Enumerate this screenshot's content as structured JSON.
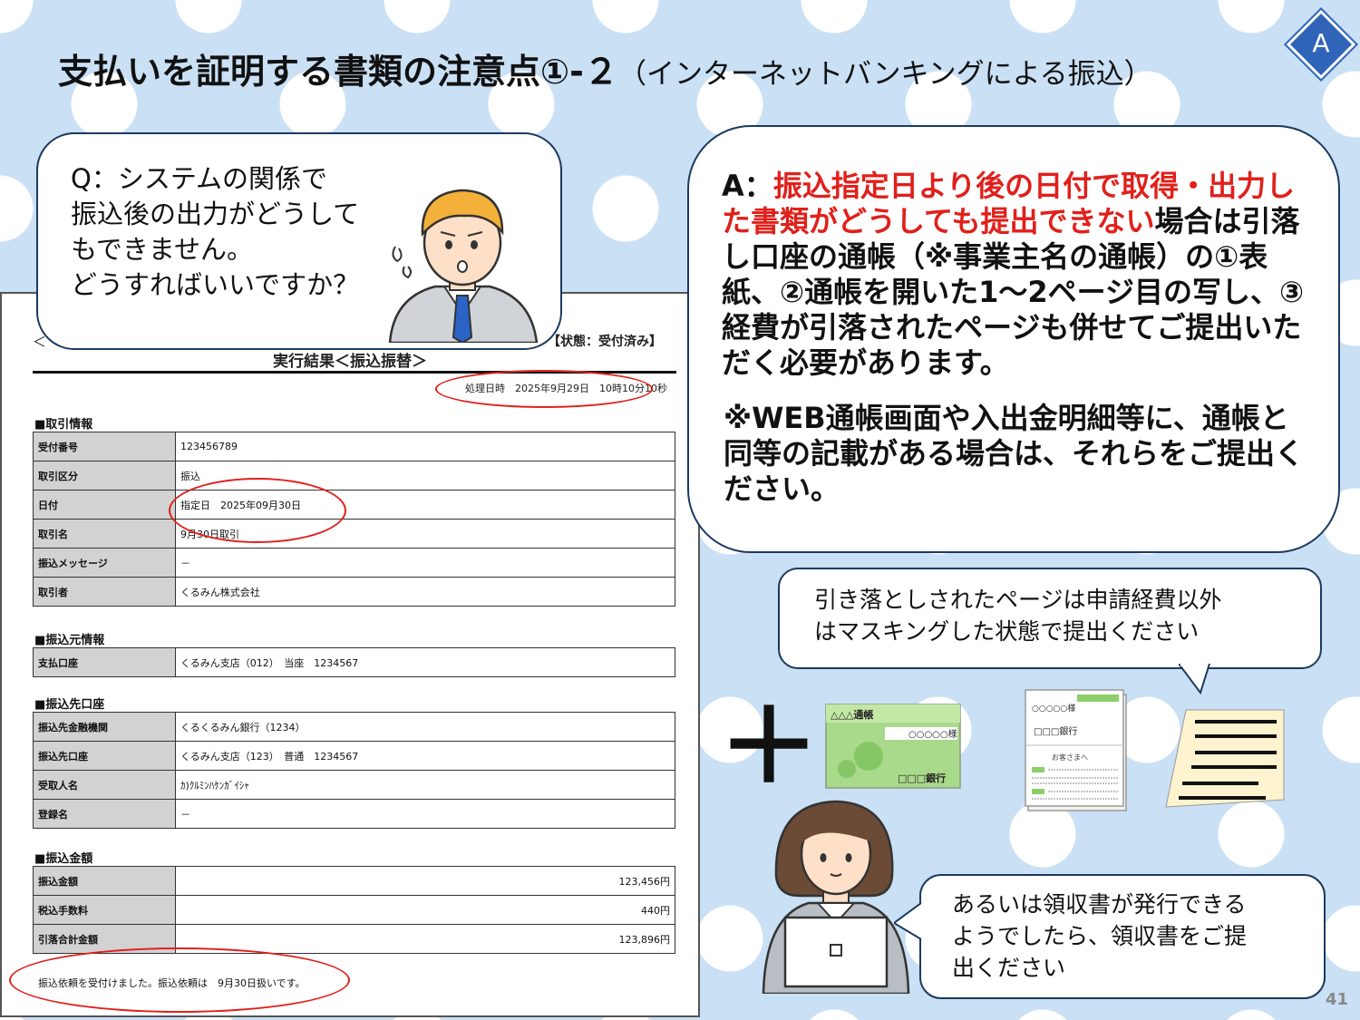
{
  "title": {
    "main": "支払いを証明する書類の注意点①-２",
    "sub": "（インターネットバンキングによる振込）"
  },
  "badge": "A",
  "page_number": "41",
  "question": {
    "lines": [
      "Q：システムの関係で",
      "振込後の出力がどうして",
      "もできません。",
      "どうすればいいですか？"
    ]
  },
  "answer": {
    "prefix": "A：",
    "red": "振込指定日より後の日付で取得・出力した書類がどうしても提出できない",
    "rest": "場合は引落し口座の通帳（※事業主名の通帳）の①表紙、②通帳を開いた1～2ページ目の写し、③経費が引落されたページも併せてご提出いただく必要があります。",
    "note": "※WEB通帳画面や入出金明細等に、通帳と同等の記載がある場合は、それらをご提出ください。"
  },
  "masking_note": {
    "lines": [
      "引き落としされたページは申請経費以外",
      "はマスキングした状態で提出ください"
    ]
  },
  "receipt_note": {
    "lines": [
      "あるいは領収書が発行できる",
      "ようでしたら、領収書をご提",
      "出ください"
    ]
  },
  "plus": "＋",
  "passbook": {
    "bank_title": "△△△通帳",
    "holder": "○○○○○様",
    "bank": "□□□銀行"
  },
  "passbook_open": {
    "holder": "○○○○○様",
    "bank": "□□□銀行",
    "greeting": "お客さまへ"
  },
  "document": {
    "left_bracket": "＜",
    "status": "【状態：受付済み】",
    "title": "実行結果＜振込振替＞",
    "processed": "処理日時　2025年9月29日　10時10分10秒",
    "sections": [
      {
        "heading": "■取引情報",
        "rows": [
          {
            "k": "受付番号",
            "v": "123456789"
          },
          {
            "k": "取引区分",
            "v": "振込"
          },
          {
            "k": "日付",
            "v": "指定日　2025年09月30日"
          },
          {
            "k": "取引名",
            "v": "9月30日取引"
          },
          {
            "k": "振込メッセージ",
            "v": "－"
          },
          {
            "k": "取引者",
            "v": "くるみん株式会社"
          }
        ]
      },
      {
        "heading": "■振込元情報",
        "rows": [
          {
            "k": "支払口座",
            "v": "くるみん支店（012）　当座　1234567"
          }
        ]
      },
      {
        "heading": "■振込先口座",
        "rows": [
          {
            "k": "振込先金融機関",
            "v": "くるくるみん銀行（1234）"
          },
          {
            "k": "振込先口座",
            "v": "くるみん支店（123）　普通　1234567"
          },
          {
            "k": "受取人名",
            "v": "ｶ)ｸﾙﾐﾝﾊｹﾝｶﾞｲｼｬ"
          },
          {
            "k": "登録名",
            "v": "－"
          }
        ]
      },
      {
        "heading": "■振込金額",
        "rows": [
          {
            "k": "振込金額",
            "v": "123,456円"
          },
          {
            "k": "税込手数料",
            "v": "440円"
          },
          {
            "k": "引落合計金額",
            "v": "123,896円"
          }
        ]
      }
    ],
    "footer": "振込依頼を受付けました。振込依頼は　9月30日扱いです。"
  },
  "colors": {
    "background": "#c9e0f5",
    "accent_red": "#e0201b",
    "badge": "#2f64b9",
    "bubble_border": "#1c3a5e"
  }
}
